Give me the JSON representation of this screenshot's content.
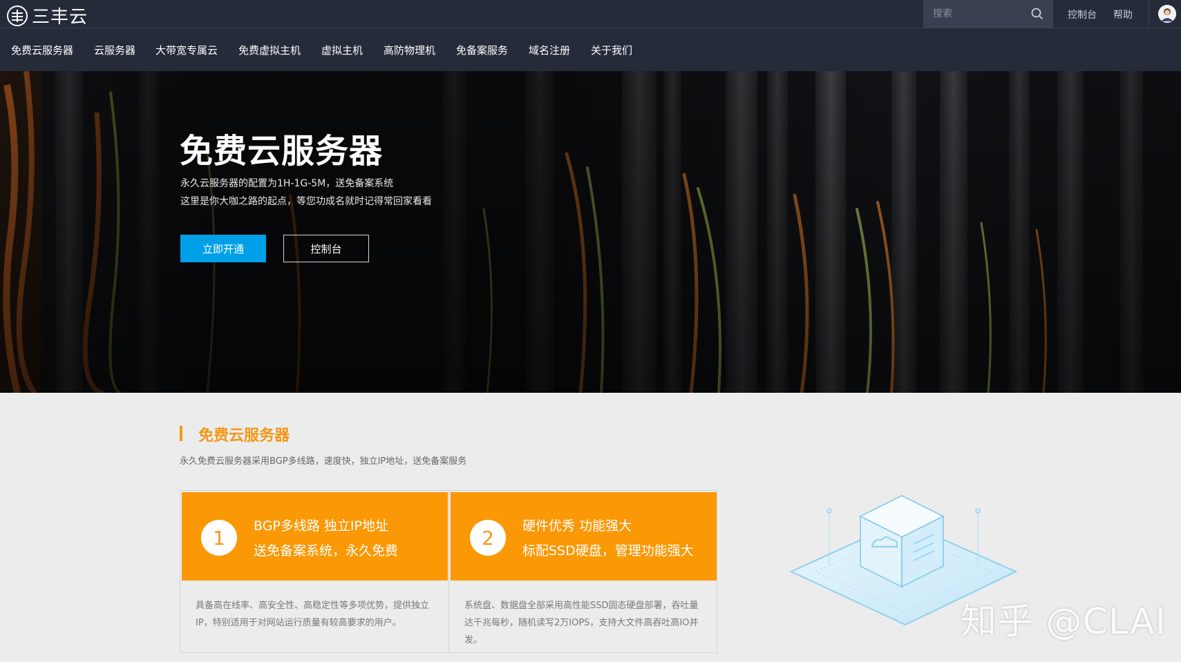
{
  "header": {
    "logo_text": "三丰云",
    "search": {
      "placeholder": "搜索"
    },
    "links": {
      "console": "控制台",
      "help": "帮助"
    },
    "avatar_icon": "user-avatar-icon"
  },
  "nav": {
    "items": [
      {
        "label": "免费云服务器"
      },
      {
        "label": "云服务器"
      },
      {
        "label": "大带宽专属云"
      },
      {
        "label": "免费虚拟主机"
      },
      {
        "label": "虚拟主机"
      },
      {
        "label": "高防物理机"
      },
      {
        "label": "免备案服务"
      },
      {
        "label": "域名注册"
      },
      {
        "label": "关于我们"
      }
    ]
  },
  "hero": {
    "title": "免费云服务器",
    "line1": "永久云服务器的配置为1H-1G-5M，送免备案系统",
    "line2": "这里是你大咖之路的起点，等您功成名就时记得常回家看看",
    "primary_button": "立即开通",
    "secondary_button": "控制台"
  },
  "section": {
    "title": "免费云服务器",
    "description": "永久免费云服务器采用BGP多线路，速度快，独立IP地址，送免备案服务",
    "accent_color": "#f49717"
  },
  "cards": [
    {
      "number": "1",
      "line1": "BGP多线路    独立IP地址",
      "line2": "送免备案系统，永久免费",
      "body": "具备高在线率、高安全性、高稳定性等多项优势，提供独立IP，特别适用于对网站运行质量有较高要求的用户。"
    },
    {
      "number": "2",
      "line1": "硬件优秀    功能强大",
      "line2": "标配SSD硬盘，管理功能强大",
      "body": "系统盘、数据盘全部采用高性能SSD固态硬盘部署，吞吐量达千兆每秒，随机读写2万IOPS，支持大文件高吞吐高IO并发。"
    }
  ],
  "watermark": "知乎 @CLAI",
  "colors": {
    "topbar": "#262b3a",
    "primary_button": "#00a0e9",
    "card_orange": "#fa9806"
  }
}
